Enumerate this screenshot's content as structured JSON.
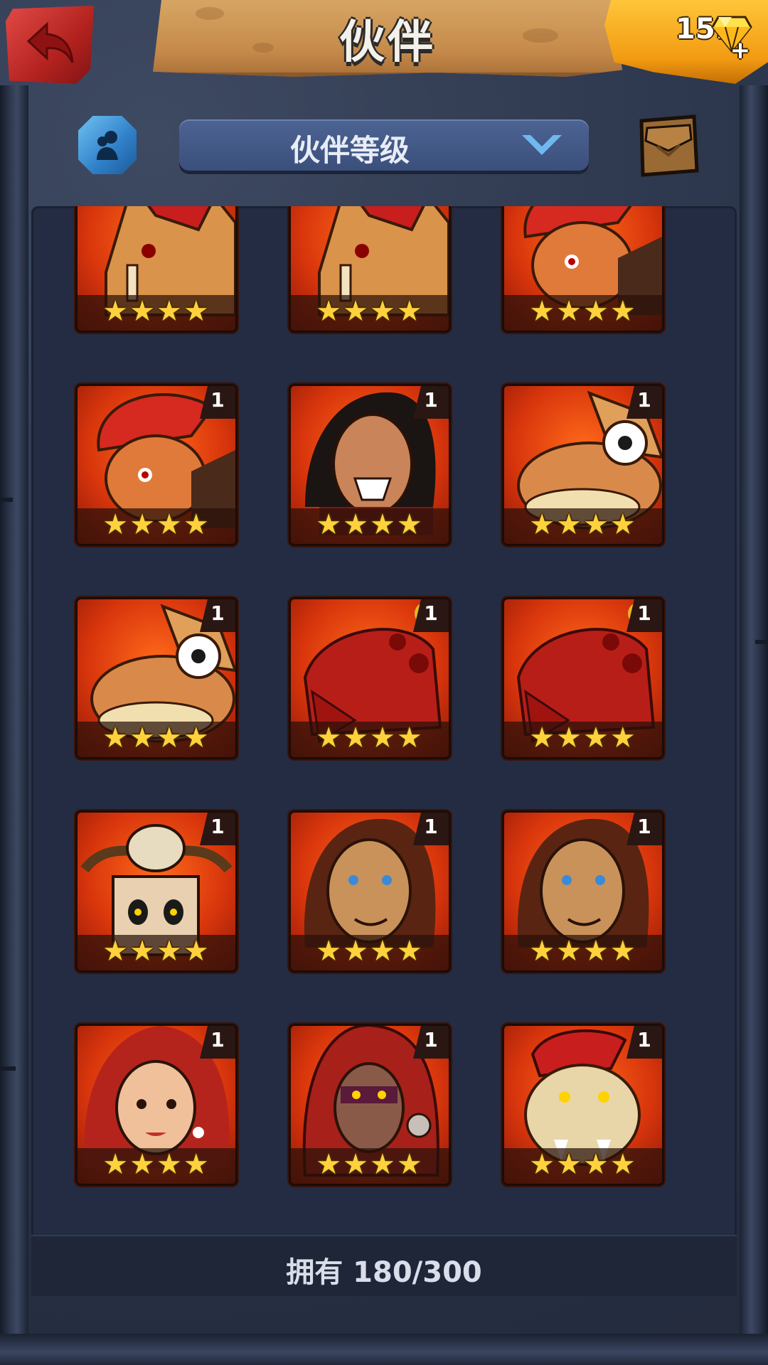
{
  "header": {
    "title": "伙伴",
    "back_icon": "back-arrow-icon",
    "currency": {
      "value": "151",
      "icon": "gem-icon",
      "add_icon": "plus-icon",
      "add_label": "+"
    }
  },
  "controls": {
    "filter_icon": "companion-filter-icon",
    "sort_label": "伙伴等级",
    "sort_icon": "chevron-down-icon",
    "inventory_icon": "bag-icon"
  },
  "companions": [
    {
      "name": "sabertooth-beast",
      "level": "1",
      "stars": "★★★★"
    },
    {
      "name": "sabertooth-beast",
      "level": "1",
      "stars": "★★★★"
    },
    {
      "name": "red-haired-dwarf",
      "level": "1",
      "stars": "★★★★"
    },
    {
      "name": "red-haired-dwarf",
      "level": "1",
      "stars": "★★★★"
    },
    {
      "name": "black-haired-warrior",
      "level": "1",
      "stars": "★★★★"
    },
    {
      "name": "one-eyed-fish",
      "level": "1",
      "stars": "★★★★"
    },
    {
      "name": "one-eyed-fish",
      "level": "1",
      "stars": "★★★★"
    },
    {
      "name": "red-crab-beast",
      "level": "1",
      "stars": "★★★★"
    },
    {
      "name": "red-crab-beast",
      "level": "1",
      "stars": "★★★★"
    },
    {
      "name": "skull-shaman",
      "level": "1",
      "stars": "★★★★"
    },
    {
      "name": "brown-haired-warrior",
      "level": "1",
      "stars": "★★★★"
    },
    {
      "name": "brown-haired-warrior",
      "level": "1",
      "stars": "★★★★"
    },
    {
      "name": "red-haired-woman",
      "level": "1",
      "stars": "★★★★"
    },
    {
      "name": "hooded-assassin",
      "level": "1",
      "stars": "★★★★"
    },
    {
      "name": "crested-lizard-beast",
      "level": "1",
      "stars": "★★★★"
    }
  ],
  "footer": {
    "owned_text": "拥有 180/300"
  },
  "colors": {
    "card_bg": "#d9360c",
    "star": "#ffd23d",
    "banner": "#c58a4a",
    "currency": "#f29b12"
  }
}
